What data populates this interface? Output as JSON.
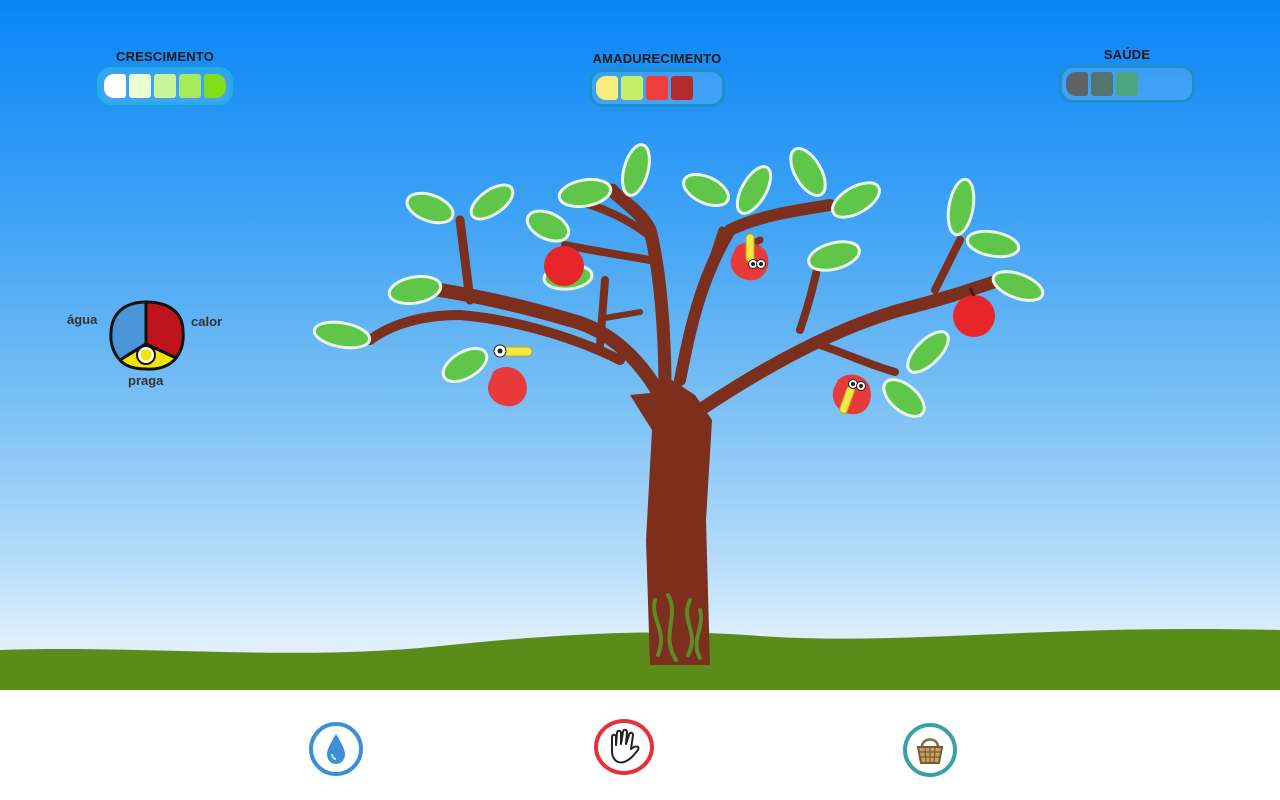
{
  "meters": {
    "growth": {
      "label": "CRESCIMENTO",
      "level": 1.0,
      "colors": [
        "#ffffff",
        "#eaffd0",
        "#c9f59a",
        "#a6eb5c",
        "#7fe01a"
      ]
    },
    "ripening": {
      "label": "AMADURECIMENTO",
      "level": 0.8,
      "colors": [
        "#f7ee7a",
        "#c6ef6a",
        "#ef3d3d",
        "#b52b2b",
        "transparent"
      ]
    },
    "health": {
      "label": "SAÚDE",
      "level": 0.6,
      "colors": [
        "#5e6466",
        "#55736a",
        "#4ba680",
        "transparent",
        "transparent"
      ]
    }
  },
  "factors": {
    "water_label": "água",
    "heat_label": "calor",
    "pest_label": "praga",
    "colors": {
      "water": "#4a94d8",
      "heat": "#c0141c",
      "pest": "#f3e600"
    }
  },
  "tools": {
    "water": {
      "icon": "water-drop-icon",
      "border": "#3d8fd8"
    },
    "hand": {
      "icon": "glove-hand-icon",
      "border": "#e53036"
    },
    "basket": {
      "icon": "basket-icon",
      "border": "#3aa0a8"
    }
  },
  "colors": {
    "grass": "#5b8c1a",
    "trunk": "#7b2f1c",
    "leaf": "#5fc64a",
    "apple": "#e8262a"
  }
}
